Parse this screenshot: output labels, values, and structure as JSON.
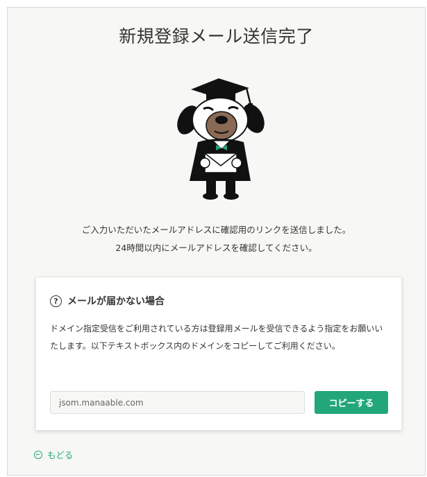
{
  "page": {
    "title": "新規登録メール送信完了",
    "message_line1": "ご入力いただいたメールアドレスに確認用のリンクを送信しました。",
    "message_line2": "24時間以内にメールアドレスを確認してください。"
  },
  "help_card": {
    "icon": "question-circle-icon",
    "title": "メールが届かない場合",
    "description": "ドメイン指定受信をご利用されている方は登録用メールを受信できるよう指定をお願いいたします。以下テキストボックス内のドメインをコピーしてご利用ください。",
    "domain_value": "jsom.manaable.com",
    "copy_button_label": "コピーする"
  },
  "back_link": {
    "icon": "back-arrow-circle-icon",
    "label": "もどる"
  },
  "colors": {
    "accent": "#23a77a",
    "background": "#f7f7f5"
  }
}
